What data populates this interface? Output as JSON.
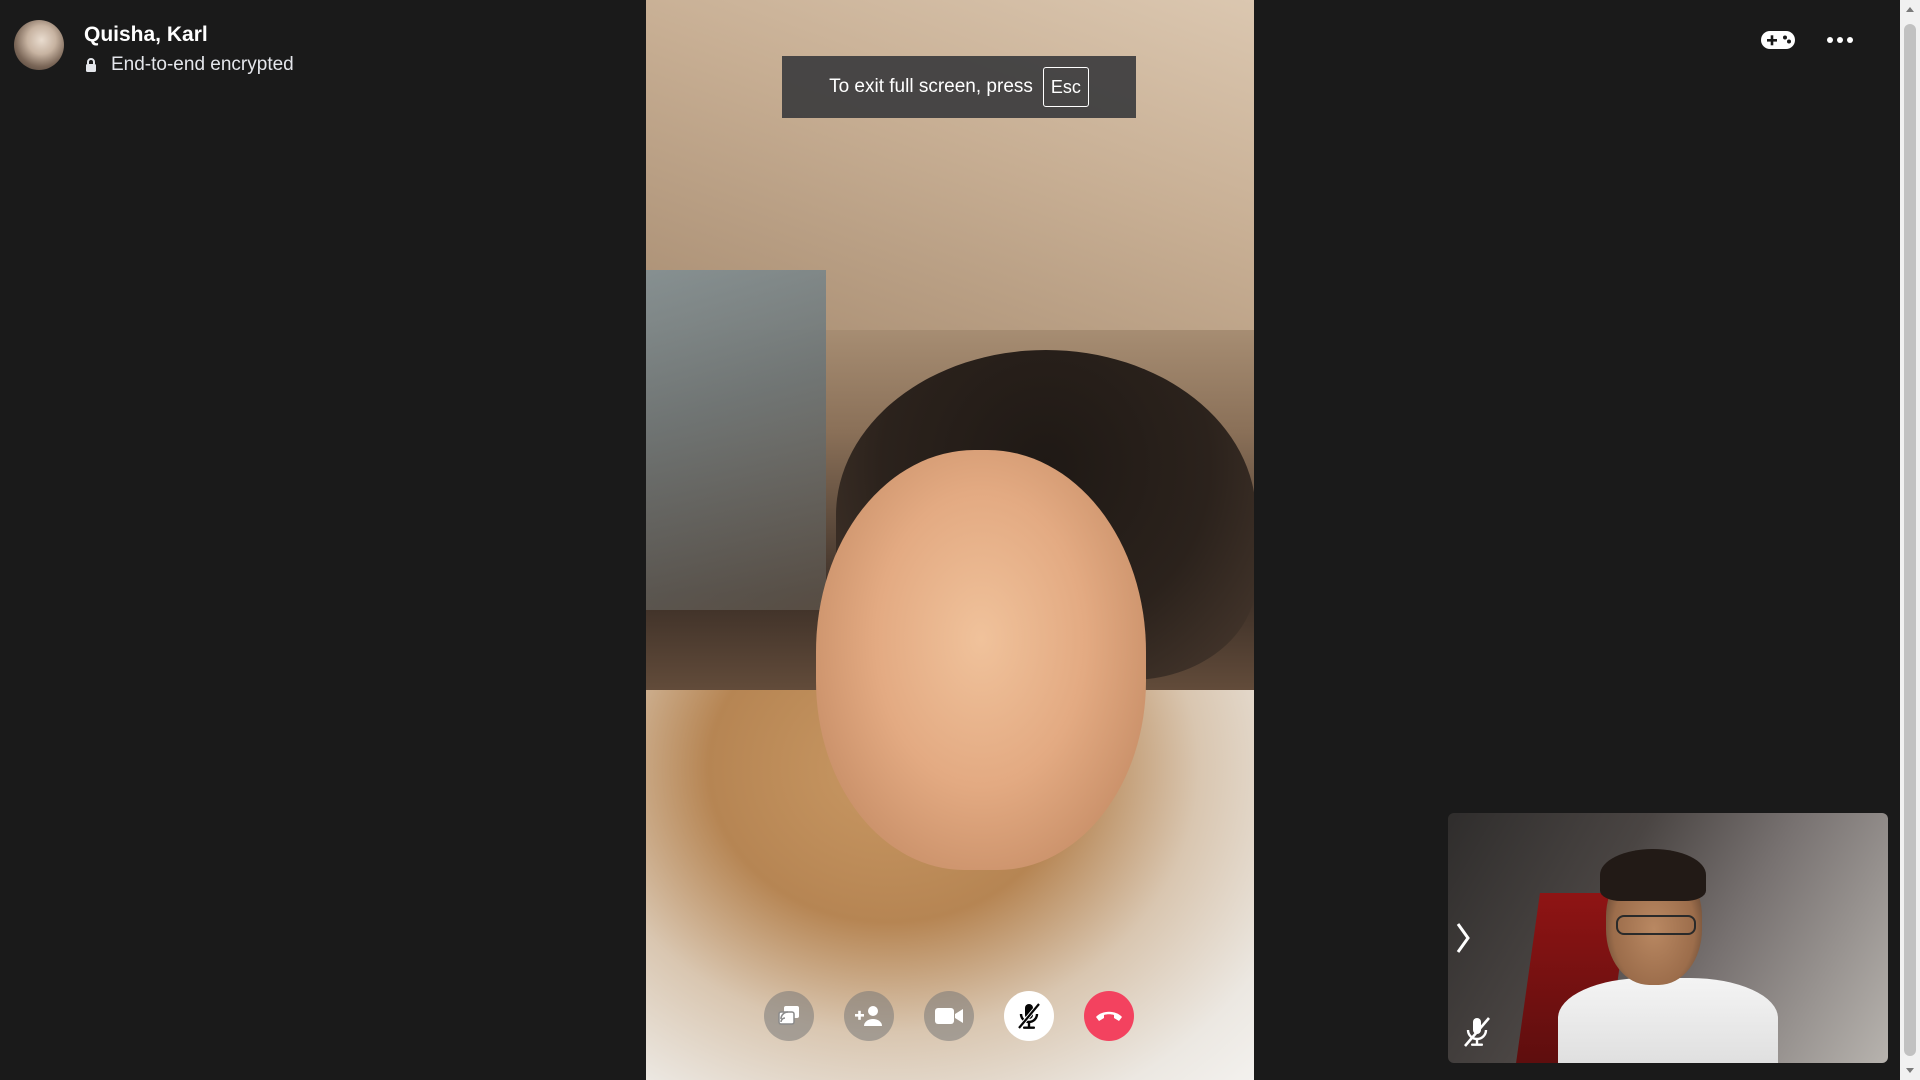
{
  "caller": {
    "name": "Quisha, Karl",
    "encryption_label": "End-to-end encrypted",
    "avatar_icon": "profile-photo"
  },
  "top_actions": {
    "game_icon": "gamepad-icon",
    "more_icon": "more-options-icon"
  },
  "toast": {
    "text": "To exit full screen, press",
    "key": "Esc"
  },
  "controls": [
    {
      "name": "share-screen-button",
      "icon": "share-screen-icon"
    },
    {
      "name": "add-person-button",
      "icon": "add-person-icon"
    },
    {
      "name": "camera-button",
      "icon": "video-camera-icon"
    },
    {
      "name": "mute-button",
      "icon": "mic-muted-icon"
    },
    {
      "name": "end-call-button",
      "icon": "phone-hangup-icon"
    }
  ],
  "colors": {
    "background": "#1a1a1a",
    "end_call": "#f3425f",
    "mute_active": "#ffffff",
    "toast_bg": "#3c3c3e"
  }
}
